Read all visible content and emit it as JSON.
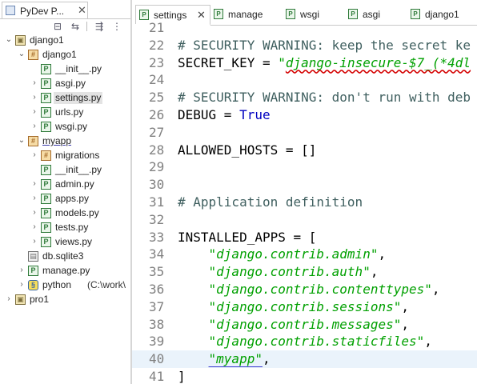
{
  "explorer": {
    "title": "PyDev P...",
    "tree": [
      {
        "label": "django1",
        "depth": 0,
        "expanded": true,
        "icon": "project-icon"
      },
      {
        "label": "django1",
        "depth": 1,
        "expanded": true,
        "icon": "package-icon"
      },
      {
        "label": "__init__.py",
        "depth": 2,
        "icon": "python-file-icon"
      },
      {
        "label": "asgi.py",
        "depth": 2,
        "collapsed": true,
        "icon": "python-file-icon"
      },
      {
        "label": "settings.py",
        "depth": 2,
        "collapsed": true,
        "icon": "python-file-icon",
        "selected": true
      },
      {
        "label": "urls.py",
        "depth": 2,
        "collapsed": true,
        "icon": "python-file-icon"
      },
      {
        "label": "wsgi.py",
        "depth": 2,
        "collapsed": true,
        "icon": "python-file-icon"
      },
      {
        "label": "myapp",
        "depth": 1,
        "expanded": true,
        "icon": "package-icon",
        "underlined": true
      },
      {
        "label": "migrations",
        "depth": 2,
        "collapsed": true,
        "icon": "package-icon"
      },
      {
        "label": "__init__.py",
        "depth": 2,
        "icon": "python-file-icon"
      },
      {
        "label": "admin.py",
        "depth": 2,
        "collapsed": true,
        "icon": "python-file-icon"
      },
      {
        "label": "apps.py",
        "depth": 2,
        "collapsed": true,
        "icon": "python-file-icon"
      },
      {
        "label": "models.py",
        "depth": 2,
        "collapsed": true,
        "icon": "python-file-icon"
      },
      {
        "label": "tests.py",
        "depth": 2,
        "collapsed": true,
        "icon": "python-file-icon"
      },
      {
        "label": "views.py",
        "depth": 2,
        "collapsed": true,
        "icon": "python-file-icon"
      },
      {
        "label": "db.sqlite3",
        "depth": 1,
        "icon": "database-file-icon"
      },
      {
        "label": "manage.py",
        "depth": 1,
        "collapsed": true,
        "icon": "python-file-icon"
      },
      {
        "label": "python",
        "extra": "(C:\\work\\",
        "depth": 1,
        "collapsed": true,
        "icon": "python-interpreter-icon"
      },
      {
        "label": "pro1",
        "depth": 0,
        "collapsed": true,
        "icon": "project-icon"
      }
    ]
  },
  "editor": {
    "tabs": [
      {
        "label": "settings",
        "active": true
      },
      {
        "label": "manage"
      },
      {
        "label": "wsgi"
      },
      {
        "label": "asgi"
      },
      {
        "label": "django1"
      }
    ],
    "lines": [
      {
        "n": "21",
        "parts": []
      },
      {
        "n": "22",
        "parts": [
          {
            "t": "# SECURITY WARNING: keep the secret ke",
            "c": "cm"
          }
        ]
      },
      {
        "n": "23",
        "parts": [
          {
            "t": "SECRET_KEY = ",
            "c": ""
          },
          {
            "t": "\"",
            "c": "str"
          },
          {
            "t": "django-insecure-$7_(*4dl",
            "c": "str sq"
          }
        ]
      },
      {
        "n": "24",
        "parts": []
      },
      {
        "n": "25",
        "parts": [
          {
            "t": "# SECURITY WARNING: don't run with deb",
            "c": "cm"
          }
        ]
      },
      {
        "n": "26",
        "parts": [
          {
            "t": "DEBUG = ",
            "c": ""
          },
          {
            "t": "True",
            "c": "kw"
          }
        ]
      },
      {
        "n": "27",
        "parts": []
      },
      {
        "n": "28",
        "parts": [
          {
            "t": "ALLOWED_HOSTS = []",
            "c": ""
          }
        ]
      },
      {
        "n": "29",
        "parts": []
      },
      {
        "n": "30",
        "parts": []
      },
      {
        "n": "31",
        "parts": [
          {
            "t": "# Application definition",
            "c": "cm"
          }
        ]
      },
      {
        "n": "32",
        "parts": []
      },
      {
        "n": "33",
        "parts": [
          {
            "t": "INSTALLED_APPS = [",
            "c": ""
          }
        ]
      },
      {
        "n": "34",
        "parts": [
          {
            "t": "    ",
            "c": ""
          },
          {
            "t": "\"django.contrib.admin\"",
            "c": "str"
          },
          {
            "t": ",",
            "c": ""
          }
        ]
      },
      {
        "n": "35",
        "parts": [
          {
            "t": "    ",
            "c": ""
          },
          {
            "t": "\"django.contrib.auth\"",
            "c": "str"
          },
          {
            "t": ",",
            "c": ""
          }
        ]
      },
      {
        "n": "36",
        "parts": [
          {
            "t": "    ",
            "c": ""
          },
          {
            "t": "\"django.contrib.contenttypes\"",
            "c": "str"
          },
          {
            "t": ",",
            "c": ""
          }
        ]
      },
      {
        "n": "37",
        "parts": [
          {
            "t": "    ",
            "c": ""
          },
          {
            "t": "\"django.contrib.sessions\"",
            "c": "str"
          },
          {
            "t": ",",
            "c": ""
          }
        ]
      },
      {
        "n": "38",
        "parts": [
          {
            "t": "    ",
            "c": ""
          },
          {
            "t": "\"django.contrib.messages\"",
            "c": "str"
          },
          {
            "t": ",",
            "c": ""
          }
        ]
      },
      {
        "n": "39",
        "parts": [
          {
            "t": "    ",
            "c": ""
          },
          {
            "t": "\"django.contrib.staticfiles\"",
            "c": "str"
          },
          {
            "t": ",",
            "c": ""
          }
        ]
      },
      {
        "n": "40",
        "parts": [
          {
            "t": "    ",
            "c": ""
          },
          {
            "t": "\"myapp\"",
            "c": "str sqblue"
          },
          {
            "t": ",",
            "c": ""
          }
        ],
        "current": true
      },
      {
        "n": "41",
        "parts": [
          {
            "t": "]",
            "c": ""
          }
        ]
      }
    ]
  }
}
